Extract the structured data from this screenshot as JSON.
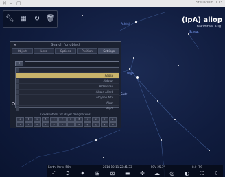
{
  "window": {
    "title": "Stellarium 0.13",
    "controls": [
      "minimize-icon",
      "maximize-icon",
      "close-icon"
    ]
  },
  "toolbar": {
    "icons": [
      "wrench-icon",
      "grid-icon",
      "refresh-icon",
      "trash-icon"
    ]
  },
  "selected_object": {
    "name": "(IpA) aliop",
    "subtitle": "nakibiraw aug"
  },
  "dialog": {
    "title": "Search for object",
    "tabs": [
      "Object",
      "Lists",
      "Options",
      "Position",
      "Settings"
    ],
    "active_tab": 4,
    "search_value": "",
    "results": [
      {
        "label": "",
        "selected": false
      },
      {
        "label": "Aeolia",
        "selected": true
      },
      {
        "label": "Aldafar",
        "selected": false
      },
      {
        "label": "Aldebaran",
        "selected": false
      },
      {
        "label": "Alkaid Alfard",
        "selected": false
      },
      {
        "label": "Alcyone Alfa",
        "selected": false
      },
      {
        "label": "Alcor",
        "selected": false
      },
      {
        "label": "Algol",
        "selected": false
      }
    ],
    "hint": "Greek letters for Bayer designations",
    "greek_letters": [
      "α",
      "β",
      "γ",
      "δ",
      "ε",
      "ζ",
      "η",
      "θ",
      "ι",
      "κ",
      "λ",
      "μ",
      "ν",
      "ξ",
      "ο",
      "π",
      "ρ",
      "σ",
      "τ",
      "υ",
      "φ",
      "χ",
      "ψ",
      "ω"
    ]
  },
  "sky": {
    "labels": [
      {
        "text": "Achird",
        "color": "#7fa3ff"
      },
      {
        "text": "Scheat",
        "color": "#7fa3ff"
      },
      {
        "text": "Vega",
        "color": "#7fa3ff"
      },
      {
        "text": "Sadr",
        "color": "#b0c4ff"
      }
    ]
  },
  "status": {
    "location": "Earth, Paris, 50m",
    "fov": "FOV 25.7°",
    "fps": "8.0 FPS",
    "datetime": "2014-10-11 22:41:33"
  },
  "bottom_icons": [
    "constellation-lines-icon",
    "constellation-labels-icon",
    "constellation-art-icon",
    "equatorial-grid-icon",
    "azimuthal-grid-icon",
    "ground-icon",
    "cardinal-points-icon",
    "atmosphere-icon",
    "nebulae-icon",
    "planets-labels-icon",
    "fullscreen-icon",
    "night-mode-icon"
  ]
}
